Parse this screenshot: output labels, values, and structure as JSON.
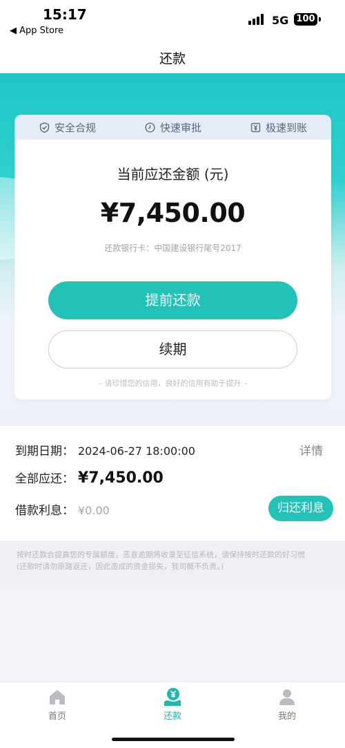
{
  "status_bar": {
    "time": "15:17",
    "back_label": "◀ App Store",
    "network": "5G",
    "battery": "100"
  },
  "nav": {
    "title": "还款"
  },
  "card": {
    "features": [
      {
        "icon": "shield-check-icon",
        "label": "安全合规"
      },
      {
        "icon": "clock-icon",
        "label": "快速审批"
      },
      {
        "icon": "yuan-icon",
        "label": "极速到账"
      }
    ],
    "amount_title": "当前应还金额 (元)",
    "amount_value": "¥7,450.00",
    "bank_line": "还款银行卡：中国建设银行尾号2017",
    "primary_button": "提前还款",
    "secondary_button": "续期",
    "tip": "– 请珍惜您的信用，良好的信用有助于提升 –"
  },
  "details": {
    "due_label": "到期日期：",
    "due_value": "2024-06-27 18:00:00",
    "detail_link": "详情",
    "total_label": "全部应还：",
    "total_value": "¥7,450.00",
    "interest_label": "借款利息：",
    "interest_value": "¥0.00",
    "interest_button": "归还利息"
  },
  "notice": {
    "line1": "按时还款会提高您的专属额度，恶意逾期将收录至征信系统，请保持按时还款的好习惯",
    "line2": "(还款时请勿原路返还，因此造成的资金损失，我司概不负责。)"
  },
  "tabs": [
    {
      "icon": "home-icon",
      "label": "首页",
      "active": false
    },
    {
      "icon": "repay-icon",
      "label": "还款",
      "active": true
    },
    {
      "icon": "user-icon",
      "label": "我的",
      "active": false
    }
  ],
  "colors": {
    "accent": "#22c2b8",
    "hero": "#1ec7c6"
  }
}
